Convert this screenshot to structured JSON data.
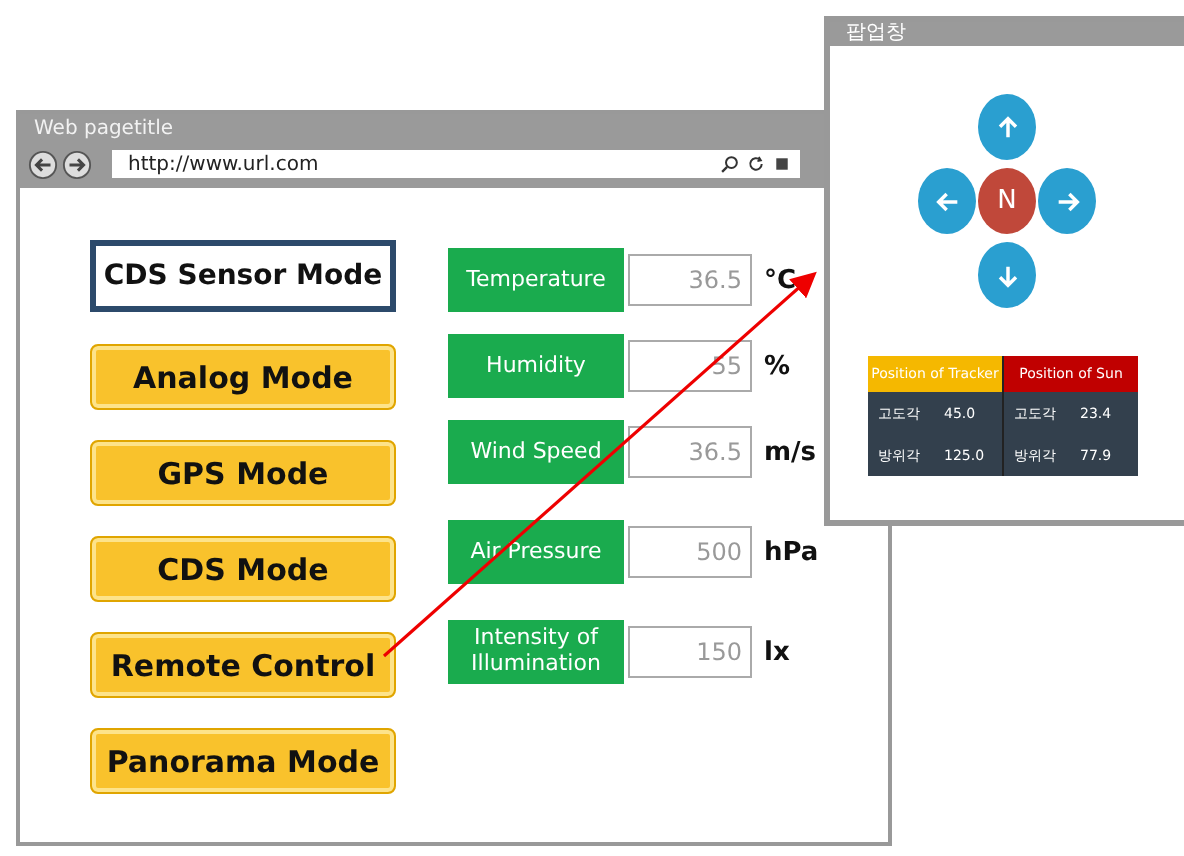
{
  "browser": {
    "title": "Web pagetitle",
    "url": "http://www.url.com"
  },
  "mode_title": "CDS Sensor Mode",
  "mode_buttons": [
    {
      "label": "Analog Mode"
    },
    {
      "label": "GPS Mode"
    },
    {
      "label": "CDS Mode"
    },
    {
      "label": "Remote Control"
    },
    {
      "label": "Panorama Mode"
    }
  ],
  "sensors": [
    {
      "name": "Temperature",
      "value": "36.5",
      "unit": "°C"
    },
    {
      "name": "Humidity",
      "value": "55",
      "unit": "%"
    },
    {
      "name": "Wind Speed",
      "value": "36.5",
      "unit": "m/s"
    },
    {
      "name": "Air Pressure",
      "value": "500",
      "unit": "hPa"
    },
    {
      "name": "Intensity of Illumination",
      "value": "150",
      "unit": "lx"
    }
  ],
  "popup": {
    "title": "팝업창",
    "center_label": "N",
    "positions": [
      {
        "title": "Position of Tracker",
        "color": "#f5b800",
        "rows": [
          {
            "label": "고도각",
            "value": "45.0"
          },
          {
            "label": "방위각",
            "value": "125.0"
          }
        ]
      },
      {
        "title": "Position of Sun",
        "color": "#c00000",
        "rows": [
          {
            "label": "고도각",
            "value": "23.4"
          },
          {
            "label": "방위각",
            "value": "77.9"
          }
        ]
      }
    ]
  }
}
